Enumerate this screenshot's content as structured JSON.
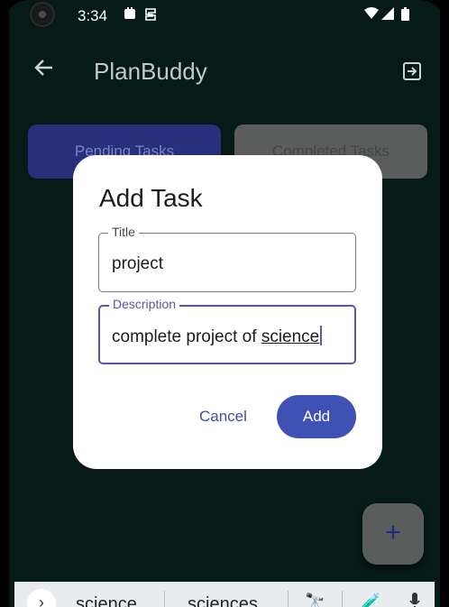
{
  "status_bar": {
    "time": "3:34"
  },
  "app_bar": {
    "title": "PlanBuddy"
  },
  "tabs": [
    {
      "label": "Pending Tasks"
    },
    {
      "label": "Completed Tasks"
    }
  ],
  "dialog": {
    "title": "Add Task",
    "title_field": {
      "label": "Title",
      "value": "project"
    },
    "description_field": {
      "label": "Description",
      "value_prefix": "complete project of ",
      "value_underlined": "science"
    },
    "cancel_label": "Cancel",
    "add_label": "Add"
  },
  "fab": {
    "label": "+"
  },
  "keyboard_suggestions": [
    "science",
    "sciences"
  ],
  "colors": {
    "accent": "#3f51b5",
    "focus": "#6750a4",
    "background": "#061a18"
  }
}
